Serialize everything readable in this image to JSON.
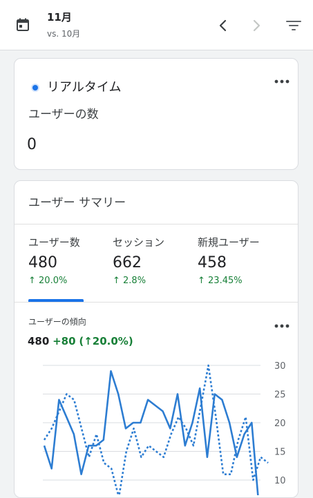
{
  "header": {
    "month": "11月",
    "compare": "vs. 10月",
    "icons": [
      "calendar-icon",
      "chevron-left-icon",
      "chevron-right-icon",
      "filter-icon"
    ]
  },
  "realtime": {
    "title": "リアルタイム",
    "label": "ユーザーの数",
    "value": "0",
    "accent": "#1a73e8"
  },
  "summary": {
    "title": "ユーザー サマリー",
    "metrics": [
      {
        "label": "ユーザー数",
        "value": "480",
        "change": "20.0%"
      },
      {
        "label": "セッション",
        "value": "662",
        "change": "2.8%"
      },
      {
        "label": "新規ユーザー",
        "value": "458",
        "change": "23.45%"
      }
    ],
    "trend": {
      "title": "ユーザーの傾向",
      "total": "480",
      "delta": "+80",
      "delta_pct": "20.0%"
    }
  },
  "colors": {
    "accent": "#1a73e8",
    "positive": "#188038",
    "line": "#2d7dd2"
  },
  "chart_data": {
    "type": "line",
    "y_ticks": [
      "30",
      "25",
      "20",
      "15",
      "10"
    ],
    "ylim": [
      10,
      30
    ],
    "series": [
      {
        "style": "solid",
        "values": [
          16,
          12,
          24,
          21,
          18,
          11,
          16,
          16,
          17,
          29,
          25,
          19,
          20,
          20,
          24,
          23,
          22,
          19,
          25,
          16,
          20,
          26,
          14,
          25,
          24,
          20,
          14,
          18,
          20,
          5
        ]
      },
      {
        "style": "dotted",
        "values": [
          17,
          19,
          22,
          25,
          24,
          19,
          14,
          18,
          13,
          12,
          7,
          15,
          19,
          14,
          16,
          15,
          14,
          18,
          21,
          19,
          16,
          23,
          30,
          21,
          11,
          11,
          17,
          21,
          10,
          14,
          13
        ]
      }
    ]
  }
}
